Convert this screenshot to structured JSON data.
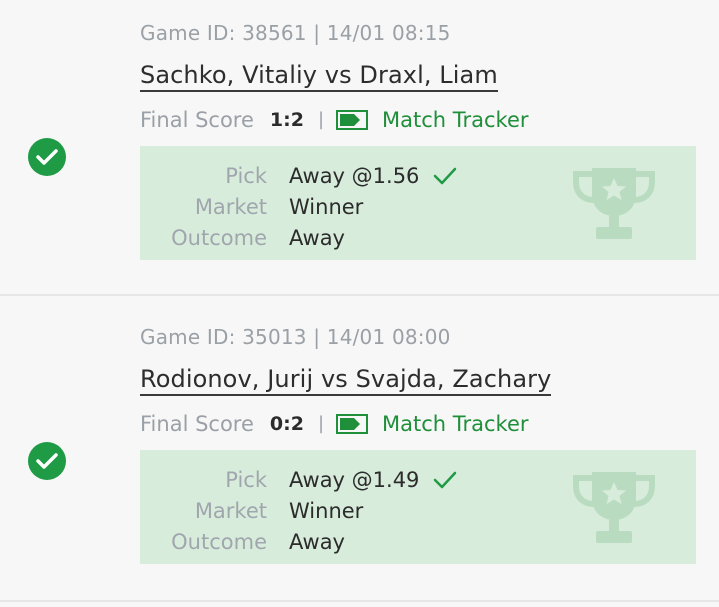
{
  "colors": {
    "win_green": "#1f9a45",
    "pick_bg": "#d8ecdc",
    "trophy": "#b9dcc1"
  },
  "bets": [
    {
      "status_icon": "check-circle-icon",
      "game_meta": "Game ID: 38561 | 14/01 08:15",
      "match": "Sachko, Vitaliy vs Draxl, Liam",
      "score_label": "Final Score",
      "score": "1:2",
      "separator": "|",
      "tracker_label": "Match Tracker",
      "rows": [
        {
          "label": "Pick",
          "value": "Away @1.56"
        },
        {
          "label": "Market",
          "value": "Winner"
        },
        {
          "label": "Outcome",
          "value": "Away"
        }
      ]
    },
    {
      "status_icon": "check-circle-icon",
      "game_meta": "Game ID: 35013 | 14/01 08:00",
      "match": "Rodionov, Jurij vs Svajda, Zachary",
      "score_label": "Final Score",
      "score": "0:2",
      "separator": "|",
      "tracker_label": "Match Tracker",
      "rows": [
        {
          "label": "Pick",
          "value": "Away @1.49"
        },
        {
          "label": "Market",
          "value": "Winner"
        },
        {
          "label": "Outcome",
          "value": "Away"
        }
      ]
    }
  ]
}
